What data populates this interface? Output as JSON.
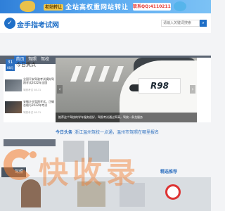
{
  "banner": {
    "tag": "老站转让",
    "slogan": "全站高权重网站转让",
    "contact": "联系QQ:411021133"
  },
  "header": {
    "logo_icon": "✓",
    "logo_text": "金手指考试网",
    "search_placeholder": "请输入关键词搜索",
    "search_icon": "search-icon"
  },
  "nav": {
    "items": [
      "首页",
      "驾照",
      "驾校"
    ]
  },
  "today": {
    "date_day": "31",
    "date_month": "08月",
    "title": "今日焦点",
    "items": [
      {
        "title": "全国平安驾驶考试模拟驾照考试2022年全国",
        "meta": "驾照考试  08-31"
      },
      {
        "title": "安徽企业驾照考试，正确合格与2022年考试",
        "meta": "驾照考试  08-31"
      },
      {
        "title": "西安哪家驾校正规，价格优惠学车",
        "meta": "驾照考试  08-31"
      }
    ]
  },
  "hero": {
    "plate": "R98",
    "caption": "推荐这个驾校的学车服务很好，驾照考试通过率高，驾校一条龙服务",
    "prev_icon": "chevron-left-icon",
    "next_icon": "chevron-right-icon"
  },
  "headline": {
    "label": "今日头条",
    "text": "浙江温州驾校一点通，温州市驾照在哪里报名"
  },
  "section_tab": "驾照",
  "recommend_tab": "精选推荐",
  "watermark": "快收录"
}
